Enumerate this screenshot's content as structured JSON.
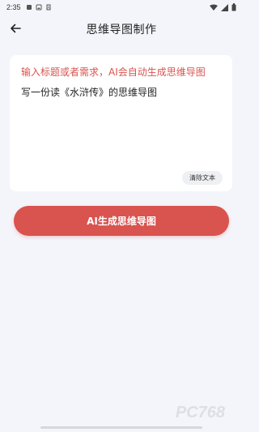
{
  "status_bar": {
    "time": "2:35",
    "left_icons": [
      "notification-icon",
      "image-icon",
      "clipboard-icon"
    ],
    "right_icons": [
      "wifi-icon",
      "signal-icon",
      "battery-icon"
    ]
  },
  "header": {
    "back_icon": "back-arrow-icon",
    "title": "思维导图制作"
  },
  "editor": {
    "placeholder": "输入标题或者需求，AI会自动生成思维导图",
    "value": "写一份读《水浒传》的思维导图",
    "clear_label": "清除文本"
  },
  "actions": {
    "generate_label": "AI生成思维导图"
  },
  "watermark": {
    "text": "PC768"
  },
  "colors": {
    "accent": "#d9534f",
    "background": "#f4f5fa",
    "card": "#ffffff"
  }
}
